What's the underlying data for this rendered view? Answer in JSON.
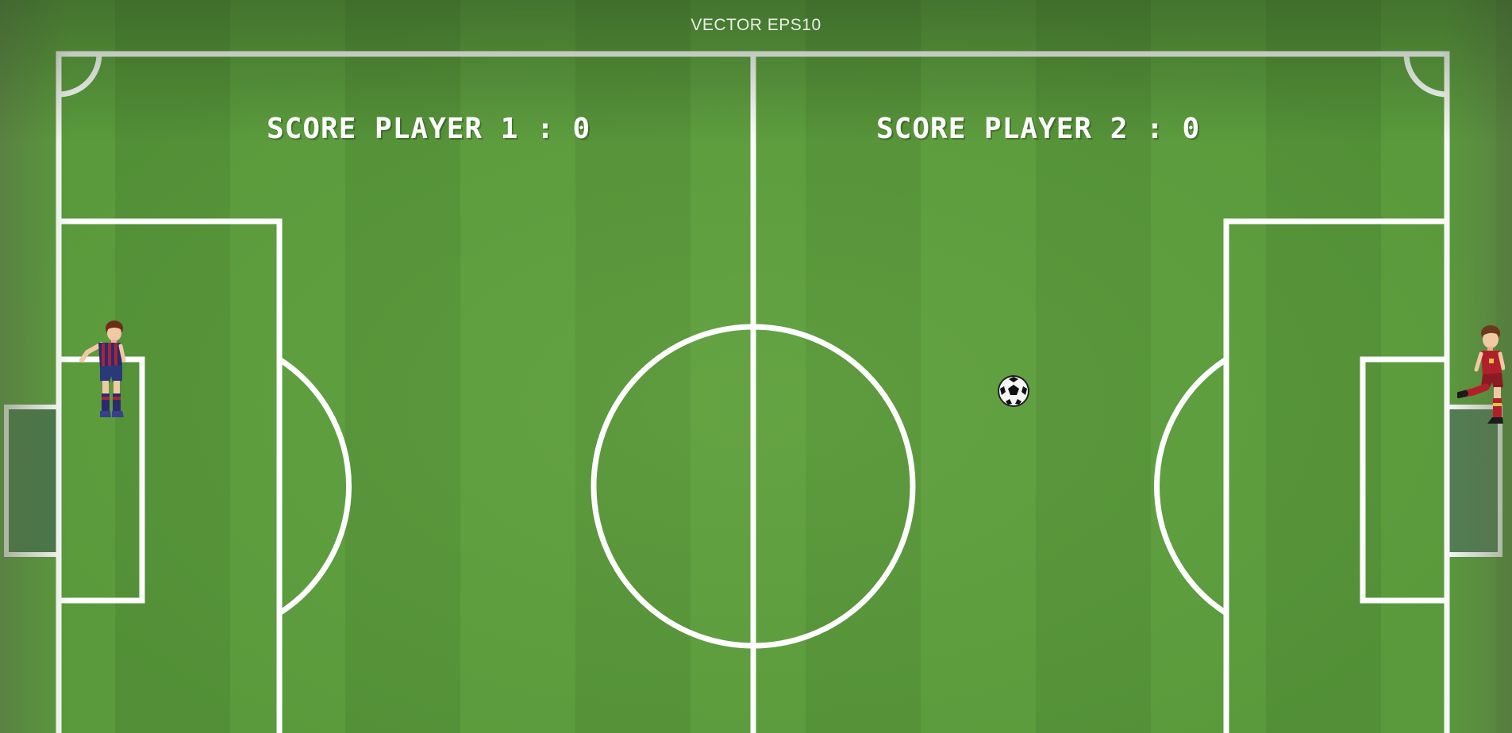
{
  "watermark": "VECTOR EPS10",
  "scoreboard": {
    "player1": {
      "label": "SCORE PLAYER 1",
      "separator": ":",
      "score": "0"
    },
    "player2": {
      "label": "SCORE PLAYER 2",
      "separator": ":",
      "score": "0"
    }
  },
  "colors": {
    "pitch_light": "#6aa84a",
    "pitch_dark": "#4f8a34",
    "lines": "#ffffff",
    "player1_kit": "#2c2a6e",
    "player1_stripes": "#a3263a",
    "player2_kit": "#b0202a"
  },
  "sprites": {
    "player1": "player-left-sprite",
    "player2": "player-right-sprite",
    "ball": "soccer-ball-icon"
  }
}
